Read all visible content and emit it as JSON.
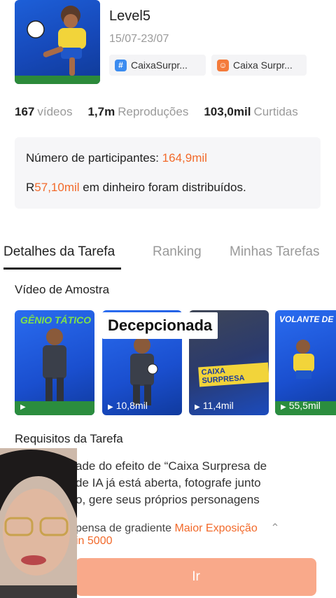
{
  "task": {
    "title": "Level5",
    "date_range": "15/07-23/07",
    "tags": [
      {
        "label": "CaixaSurpr...",
        "icon": "hashtag-icon",
        "color": "#3c8cf0"
      },
      {
        "label": "Caixa Surpr...",
        "icon": "emoji-effect-icon",
        "color": "#f47b3b"
      }
    ]
  },
  "stats": [
    {
      "value": "167",
      "label": "vídeos"
    },
    {
      "value": "1,7m",
      "label": "Reproduções"
    },
    {
      "value": "103,0mil",
      "label": "Curtidas"
    }
  ],
  "info": {
    "participants_label": "Número de participantes:",
    "participants_value": "164,9mil",
    "money_prefix": "R",
    "money_value": "57,10mil",
    "money_suffix": "em dinheiro foram distribuídos."
  },
  "tabs": [
    {
      "label": "Detalhes da Tarefa",
      "active": true
    },
    {
      "label": "Ranking",
      "active": false
    },
    {
      "label": "Minhas Tarefas",
      "active": false
    }
  ],
  "sample_section_title": "Vídeo de Amostra",
  "samples": [
    {
      "views": "",
      "caption": "GÊNIO TÁTICO"
    },
    {
      "views": "10,8mil"
    },
    {
      "views": "11,4mil",
      "caption": "CAIXA SURPRESA"
    },
    {
      "views": "55,5mil",
      "caption": "VOLANTE DE C"
    }
  ],
  "overlay_text": "Decepcionada",
  "requirements": {
    "title": "Requisitos da Tarefa",
    "lines": [
      "ade do efeito de “Caixa Surpresa de",
      "de IA já está aberta, fotografe junto",
      "o, gere seus próprios personagens"
    ]
  },
  "promo": {
    "text_part": "pensa de gradiente",
    "highlight": "Maior Exposição",
    "line2": "in 5000"
  },
  "cta_label": "Ir",
  "colors": {
    "accent": "#f26a2b",
    "cta": "#f9a98a"
  }
}
